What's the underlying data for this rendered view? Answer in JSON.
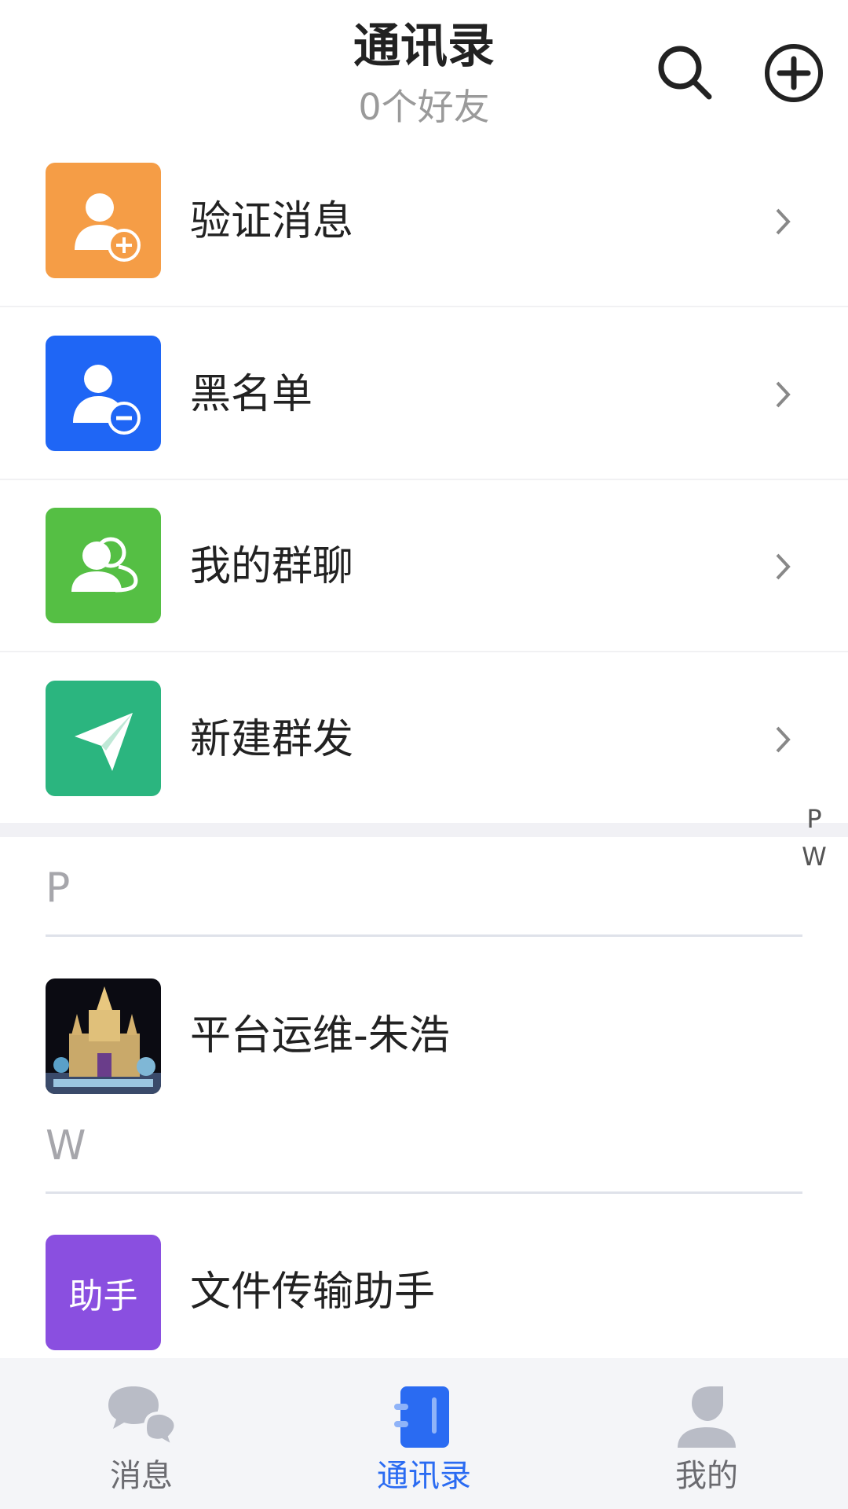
{
  "header": {
    "title": "通讯录",
    "subtitle": "0个好友",
    "search_icon": "search-icon",
    "add_icon": "add-circle-icon"
  },
  "features": [
    {
      "label": "验证消息",
      "icon": "user-add-icon",
      "color": "#f59d46"
    },
    {
      "label": "黑名单",
      "icon": "user-block-icon",
      "color": "#1f66f5"
    },
    {
      "label": "我的群聊",
      "icon": "group-icon",
      "color": "#55bf44"
    },
    {
      "label": "新建群发",
      "icon": "paper-plane-icon",
      "color": "#2bb57f"
    }
  ],
  "index_letters": [
    "P",
    "W"
  ],
  "sections": [
    {
      "letter": "P",
      "contacts": [
        {
          "name": "平台运维-朱浩",
          "avatar": "castle-photo"
        }
      ]
    },
    {
      "letter": "W",
      "contacts": [
        {
          "name": "文件传输助手",
          "avatar_text": "助手",
          "avatar_color": "#8a4fe0"
        }
      ]
    }
  ],
  "tabs": [
    {
      "label": "消息",
      "icon": "chat-bubbles-icon",
      "active": false
    },
    {
      "label": "通讯录",
      "icon": "contacts-book-icon",
      "active": true
    },
    {
      "label": "我的",
      "icon": "profile-icon",
      "active": false
    }
  ],
  "colors": {
    "accent": "#2a6bf2",
    "inactive": "#b9bcc6"
  }
}
